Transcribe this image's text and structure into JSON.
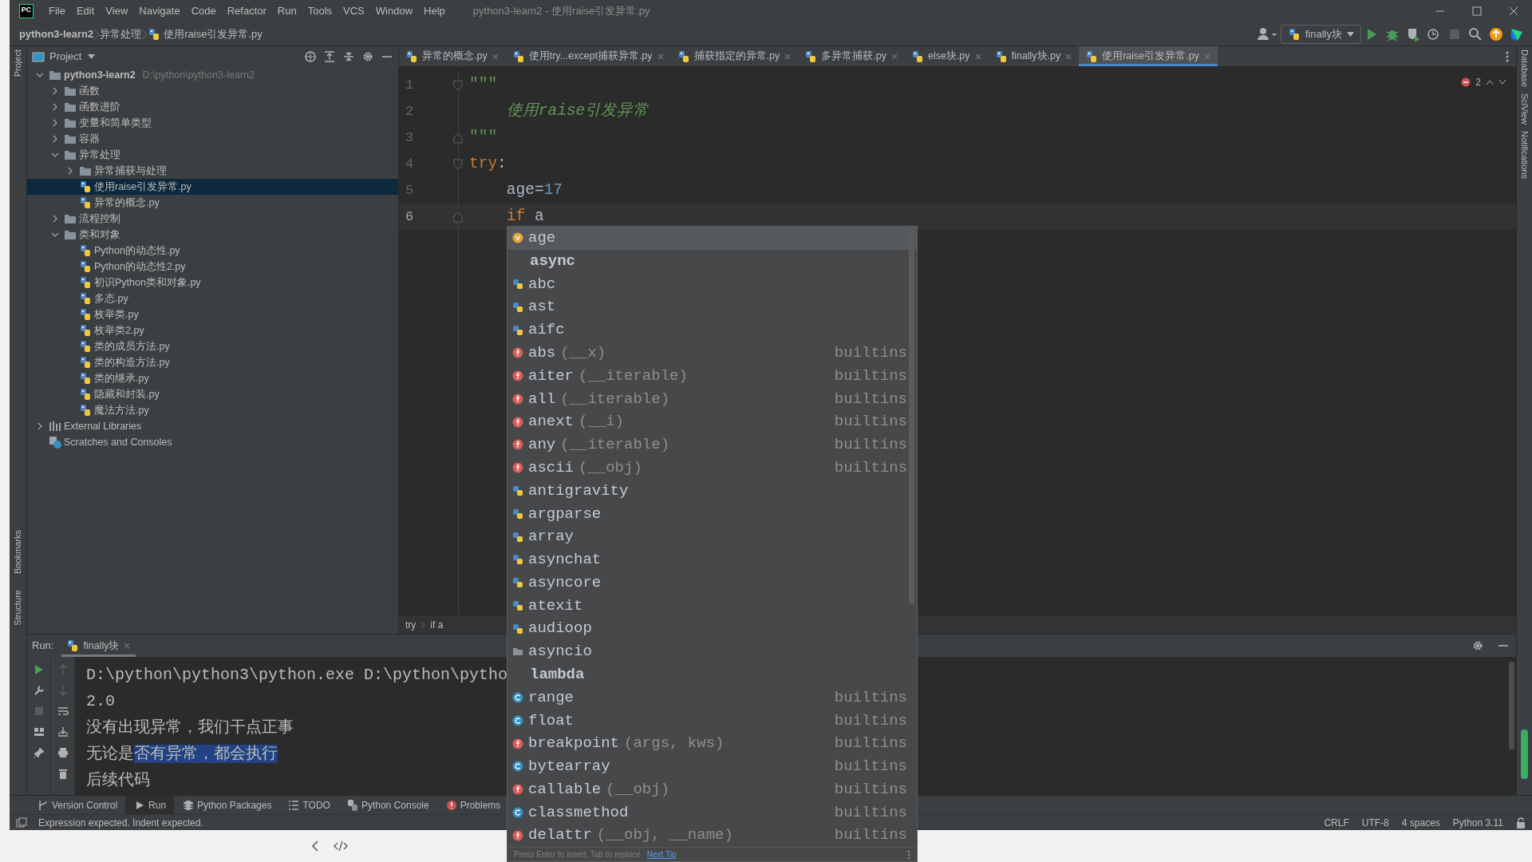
{
  "window": {
    "logo": "PC",
    "title": "python3-learn2 - 使用raise引发异常.py"
  },
  "menu": [
    "File",
    "Edit",
    "View",
    "Navigate",
    "Code",
    "Refactor",
    "Run",
    "Tools",
    "VCS",
    "Window",
    "Help"
  ],
  "breadcrumbs": [
    "python3-learn2",
    "异常处理",
    "使用raise引发异常.py"
  ],
  "run_config": "finally块",
  "side_labels": {
    "left": [
      "Project",
      "Bookmarks",
      "Structure"
    ],
    "right": [
      "Database",
      "SciView",
      "Notifications"
    ]
  },
  "project_panel": {
    "title": "Project",
    "tree": [
      {
        "name": "python3-learn2",
        "path": "D:\\python\\python3-learn2",
        "kind": "folder",
        "expanded": true,
        "selected": false,
        "children": [
          {
            "name": "函数",
            "kind": "folder",
            "expanded": false,
            "selected": false
          },
          {
            "name": "函数进阶",
            "kind": "folder",
            "expanded": false,
            "selected": false
          },
          {
            "name": "变量和简单类型",
            "kind": "folder",
            "expanded": false,
            "selected": false
          },
          {
            "name": "容器",
            "kind": "folder",
            "expanded": false,
            "selected": false
          },
          {
            "name": "异常处理",
            "kind": "folder",
            "expanded": true,
            "selected": false,
            "children": [
              {
                "name": "异常捕获与处理",
                "kind": "folder",
                "expanded": false,
                "selected": false
              },
              {
                "name": "使用raise引发异常.py",
                "kind": "file",
                "selected": true
              },
              {
                "name": "异常的概念.py",
                "kind": "file",
                "selected": false
              }
            ]
          },
          {
            "name": "流程控制",
            "kind": "folder",
            "expanded": false,
            "selected": false
          },
          {
            "name": "类和对象",
            "kind": "folder",
            "expanded": true,
            "selected": false,
            "children": [
              {
                "name": "Python的动态性.py",
                "kind": "file",
                "selected": false
              },
              {
                "name": "Python的动态性2.py",
                "kind": "file",
                "selected": false
              },
              {
                "name": "初识Python类和对象.py",
                "kind": "file",
                "selected": false
              },
              {
                "name": "多态.py",
                "kind": "file",
                "selected": false
              },
              {
                "name": "枚举类.py",
                "kind": "file",
                "selected": false
              },
              {
                "name": "枚举类2.py",
                "kind": "file",
                "selected": false
              },
              {
                "name": "类的成员方法.py",
                "kind": "file",
                "selected": false
              },
              {
                "name": "类的构造方法.py",
                "kind": "file",
                "selected": false
              },
              {
                "name": "类的继承.py",
                "kind": "file",
                "selected": false
              },
              {
                "name": "隐藏和封装.py",
                "kind": "file",
                "selected": false
              },
              {
                "name": "魔法方法.py",
                "kind": "file",
                "selected": false
              }
            ]
          }
        ]
      },
      {
        "name": "External Libraries",
        "kind": "library",
        "expanded": false,
        "selected": false
      },
      {
        "name": "Scratches and Consoles",
        "kind": "scratches",
        "selected": false
      }
    ]
  },
  "editor_tabs": [
    {
      "label": "异常的概念.py",
      "selected": false
    },
    {
      "label": "使用try...except捕获异常.py",
      "selected": false
    },
    {
      "label": "捕获指定的异常.py",
      "selected": false
    },
    {
      "label": "多异常捕获.py",
      "selected": false
    },
    {
      "label": "else块.py",
      "selected": false
    },
    {
      "label": "finally块.py",
      "selected": false
    },
    {
      "label": "使用raise引发异常.py",
      "selected": true
    }
  ],
  "editor": {
    "error_count": "2",
    "lines": [
      {
        "number": "1",
        "current": false,
        "kind": "fold_start",
        "tokens": [
          {
            "kind": "string",
            "text": "\"\"\""
          }
        ]
      },
      {
        "number": "2",
        "current": false,
        "kind": "plain",
        "tokens": [
          {
            "kind": "doc",
            "text": "    使用raise引发异常"
          }
        ]
      },
      {
        "number": "3",
        "current": false,
        "kind": "fold_end",
        "tokens": [
          {
            "kind": "string",
            "text": "\"\"\""
          }
        ]
      },
      {
        "number": "4",
        "current": false,
        "kind": "fold_start",
        "tokens": [
          {
            "kind": "keyword",
            "text": "try"
          },
          {
            "kind": "plain",
            "text": ":"
          }
        ]
      },
      {
        "number": "5",
        "current": false,
        "kind": "plain",
        "tokens": [
          {
            "kind": "plain",
            "text": "    age="
          },
          {
            "kind": "number",
            "text": "17"
          }
        ]
      },
      {
        "number": "6",
        "current": true,
        "kind": "fold_end",
        "tokens": [
          {
            "kind": "keyword",
            "text": "    if"
          },
          {
            "kind": "plain",
            "text": " a"
          }
        ]
      }
    ],
    "breadcrumbs": [
      "try",
      "if a"
    ]
  },
  "completion": {
    "items": [
      {
        "kind": "variable",
        "name": "age",
        "selected": true
      },
      {
        "kind": "keyword",
        "name": "async",
        "selected": false
      },
      {
        "kind": "module",
        "name": "abc",
        "selected": false
      },
      {
        "kind": "module",
        "name": "ast",
        "selected": false
      },
      {
        "kind": "module",
        "name": "aifc",
        "selected": false
      },
      {
        "kind": "function",
        "name": "abs",
        "params": "(__x)",
        "source": "builtins",
        "selected": false
      },
      {
        "kind": "function",
        "name": "aiter",
        "params": "(__iterable)",
        "source": "builtins",
        "selected": false
      },
      {
        "kind": "function",
        "name": "all",
        "params": "(__iterable)",
        "source": "builtins",
        "selected": false
      },
      {
        "kind": "function",
        "name": "anext",
        "params": "(__i)",
        "source": "builtins",
        "selected": false
      },
      {
        "kind": "function",
        "name": "any",
        "params": "(__iterable)",
        "source": "builtins",
        "selected": false
      },
      {
        "kind": "function",
        "name": "ascii",
        "params": "(__obj)",
        "source": "builtins",
        "selected": false
      },
      {
        "kind": "module",
        "name": "antigravity",
        "selected": false
      },
      {
        "kind": "module",
        "name": "argparse",
        "selected": false
      },
      {
        "kind": "module",
        "name": "array",
        "selected": false
      },
      {
        "kind": "module",
        "name": "asynchat",
        "selected": false
      },
      {
        "kind": "module",
        "name": "asyncore",
        "selected": false
      },
      {
        "kind": "module",
        "name": "atexit",
        "selected": false
      },
      {
        "kind": "module",
        "name": "audioop",
        "selected": false
      },
      {
        "kind": "package",
        "name": "asyncio",
        "selected": false
      },
      {
        "kind": "keyword",
        "name": "lambda",
        "selected": false
      },
      {
        "kind": "class",
        "name": "range",
        "source": "builtins",
        "selected": false
      },
      {
        "kind": "class",
        "name": "float",
        "source": "builtins",
        "selected": false
      },
      {
        "kind": "function",
        "name": "breakpoint",
        "params": "(args, kws)",
        "source": "builtins",
        "selected": false
      },
      {
        "kind": "class",
        "name": "bytearray",
        "source": "builtins",
        "selected": false
      },
      {
        "kind": "function",
        "name": "callable",
        "params": "(__obj)",
        "source": "builtins",
        "selected": false
      },
      {
        "kind": "class",
        "name": "classmethod",
        "source": "builtins",
        "selected": false
      },
      {
        "kind": "function",
        "name": "delattr",
        "params": "(__obj, __name)",
        "source": "builtins",
        "selected": false
      }
    ],
    "hint": "Press Enter to insert, Tab to replace",
    "link": "Next Tip"
  },
  "run_panel": {
    "label": "Run:",
    "tabs": [
      {
        "label": "finally块",
        "selected": true
      }
    ],
    "console": [
      {
        "segments": [
          {
            "text": "D:\\python\\python3\\python.exe D:\\python\\pytho",
            "selected": false
          }
        ]
      },
      {
        "segments": [
          {
            "text": "2.0",
            "selected": false
          }
        ]
      },
      {
        "segments": [
          {
            "text": "没有出现异常，我们干点正事",
            "selected": false
          }
        ]
      },
      {
        "segments": [
          {
            "text": "无论是",
            "selected": false
          },
          {
            "text": "否有异常，都会执行",
            "selected": true
          }
        ]
      },
      {
        "segments": [
          {
            "text": "后续代码",
            "selected": false
          }
        ]
      }
    ]
  },
  "tool_tabs": [
    {
      "label": "Version Control",
      "kind": "branch",
      "selected": false
    },
    {
      "label": "Run",
      "kind": "run",
      "selected": true
    },
    {
      "label": "Python Packages",
      "kind": "layers",
      "selected": false
    },
    {
      "label": "TODO",
      "kind": "list",
      "selected": false
    },
    {
      "label": "Python Console",
      "kind": "python",
      "selected": false
    },
    {
      "label": "Problems",
      "kind": "error",
      "selected": false
    }
  ],
  "status_bar": {
    "message": "Expression expected. Indent expected.",
    "items": [
      "CRLF",
      "UTF-8",
      "4 spaces",
      "Python 3.11"
    ]
  }
}
